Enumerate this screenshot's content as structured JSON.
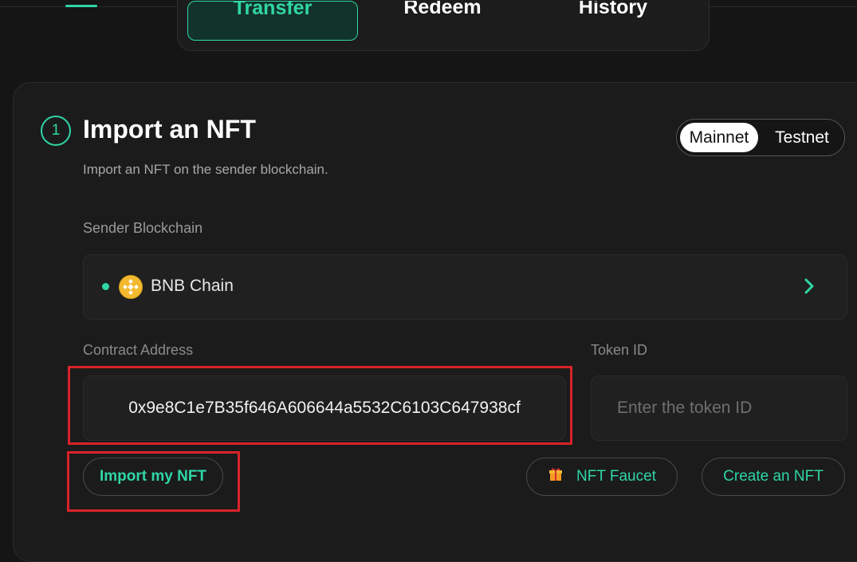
{
  "tabs": [
    {
      "label": "Transfer",
      "active": true
    },
    {
      "label": "Redeem",
      "active": false
    },
    {
      "label": "History",
      "active": false
    }
  ],
  "step": {
    "number": "1",
    "title": "Import an NFT",
    "subtitle": "Import an NFT on the sender blockchain."
  },
  "network": {
    "options": [
      "Mainnet",
      "Testnet"
    ],
    "selected": "Mainnet"
  },
  "sender": {
    "label": "Sender Blockchain",
    "chain": "BNB Chain",
    "chain_icon": "bnb-logo-icon",
    "status_color": "#2fd6a6"
  },
  "contract": {
    "label": "Contract Address",
    "value": "0x9e8C1e7B35f646A606644a5532C6103C647938cf"
  },
  "token": {
    "label": "Token ID",
    "placeholder": "Enter the token ID",
    "value": ""
  },
  "actions": {
    "import_label": "Import my NFT",
    "faucet_label": "NFT Faucet",
    "faucet_icon": "gift-icon",
    "create_label": "Create an NFT"
  },
  "colors": {
    "accent": "#2fd6a6",
    "background": "#151515",
    "card": "#1b1b1b",
    "highlight_box": "#d8232a"
  }
}
